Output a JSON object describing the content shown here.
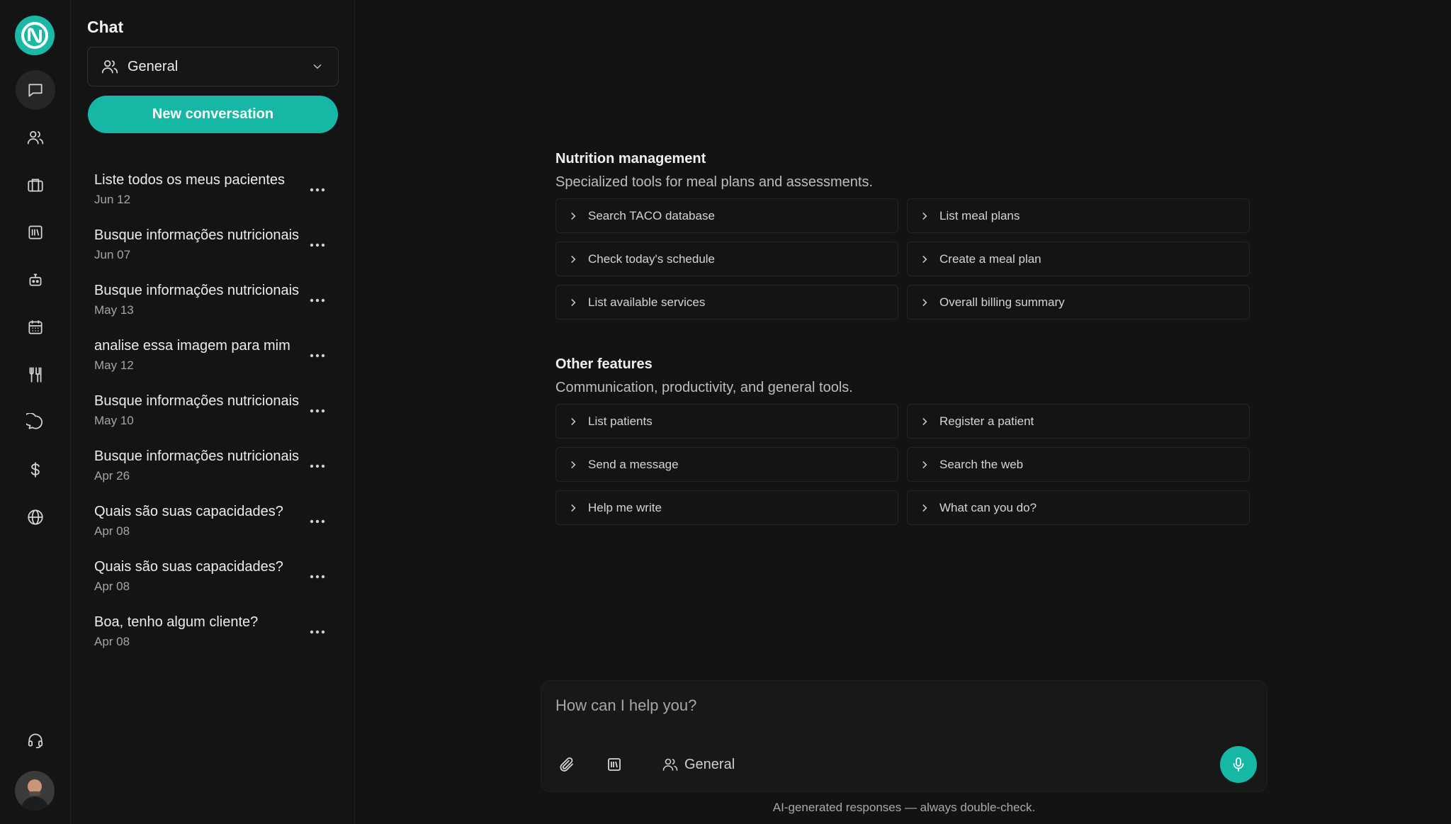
{
  "rail": {
    "items": [
      "chat-icon",
      "users-icon",
      "briefcase-icon",
      "library-icon",
      "robot-icon",
      "calendar-icon",
      "utensils-icon",
      "message-icon",
      "dollar-icon",
      "globe-icon"
    ],
    "active": "chat-icon",
    "support_icon": "headset-icon"
  },
  "sidebar": {
    "title": "Chat",
    "group_select": "General",
    "new_conversation": "New conversation",
    "conversations": [
      {
        "title": "Liste todos os meus pacientes",
        "date": "Jun 12"
      },
      {
        "title": "Busque informações nutricionais",
        "date": "Jun 07"
      },
      {
        "title": "Busque informações nutricionais",
        "date": "May 13"
      },
      {
        "title": "analise essa imagem para mim",
        "date": "May 12"
      },
      {
        "title": "Busque informações nutricionais",
        "date": "May 10"
      },
      {
        "title": "Busque informações nutricionais",
        "date": "Apr 26"
      },
      {
        "title": "Quais são suas capacidades?",
        "date": "Apr 08"
      },
      {
        "title": "Quais são suas capacidades?",
        "date": "Apr 08"
      },
      {
        "title": "Boa, tenho algum cliente?",
        "date": "Apr 08"
      }
    ]
  },
  "main": {
    "sections": [
      {
        "title": "Nutrition management",
        "description": "Specialized tools for meal plans and assessments.",
        "items": [
          "Search TACO database",
          "List meal plans",
          "Check today's schedule",
          "Create a meal plan",
          "List available services",
          "Overall billing summary"
        ]
      },
      {
        "title": "Other features",
        "description": "Communication, productivity, and general tools.",
        "items": [
          "List patients",
          "Register a patient",
          "Send a message",
          "Search the web",
          "Help me write",
          "What can you do?"
        ]
      }
    ],
    "composer": {
      "placeholder": "How can I help you?",
      "group": "General"
    },
    "disclaimer": "AI-generated responses — always double-check."
  },
  "colors": {
    "accent": "#16b8a5",
    "background": "#131313",
    "panel": "#141414"
  }
}
